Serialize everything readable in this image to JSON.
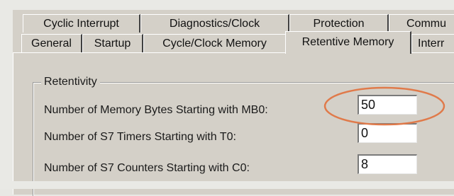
{
  "tabs": {
    "row_back": [
      {
        "label": "Cyclic Interrupt"
      },
      {
        "label": "Diagnostics/Clock"
      },
      {
        "label": "Protection"
      },
      {
        "label": "Commu"
      }
    ],
    "row_front": [
      {
        "label": "General"
      },
      {
        "label": "Startup"
      },
      {
        "label": "Cycle/Clock Memory"
      },
      {
        "label": "Retentive Memory",
        "active": true
      },
      {
        "label": "Interr"
      }
    ]
  },
  "retentivity": {
    "group_title": "Retentivity",
    "memory_bytes": {
      "label": "Number of Memory Bytes Starting with MB0:",
      "value": "50"
    },
    "s7_timers": {
      "label": "Number of S7 Timers Starting with T0:",
      "value": "0"
    },
    "s7_counters": {
      "label": "Number of S7 Counters Starting with C0:",
      "value": "8"
    }
  },
  "colors": {
    "dialog_face": "#d4d0c8",
    "highlight_ellipse": "#e07a4a"
  }
}
